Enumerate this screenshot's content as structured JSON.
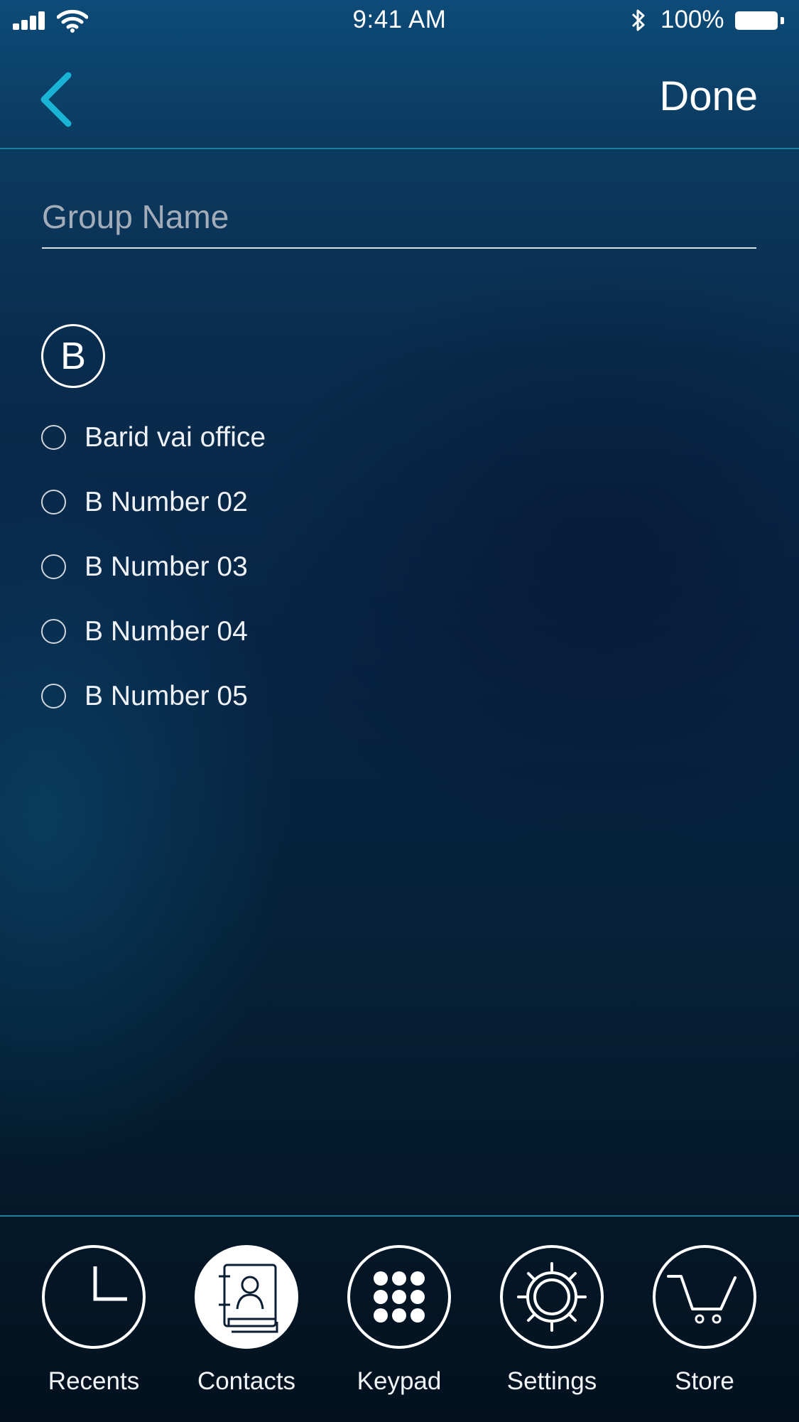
{
  "status_bar": {
    "time": "9:41 AM",
    "battery_percent": "100%",
    "icons": [
      "signal-icon",
      "wifi-icon",
      "bluetooth-icon",
      "battery-icon"
    ]
  },
  "nav": {
    "back_icon": "chevron-left-icon",
    "done_label": "Done"
  },
  "form": {
    "group_name_placeholder": "Group Name",
    "group_name_value": ""
  },
  "section": {
    "letter": "B"
  },
  "contacts": [
    {
      "name": "Barid vai office"
    },
    {
      "name": "B Number 02"
    },
    {
      "name": "B Number 03"
    },
    {
      "name": "B Number 04"
    },
    {
      "name": "B Number 05"
    }
  ],
  "tabs": [
    {
      "label": "Recents",
      "icon": "clock-icon",
      "active": false
    },
    {
      "label": "Contacts",
      "icon": "contacts-book-icon",
      "active": true
    },
    {
      "label": "Keypad",
      "icon": "keypad-icon",
      "active": false
    },
    {
      "label": "Settings",
      "icon": "gear-icon",
      "active": false
    },
    {
      "label": "Store",
      "icon": "cart-icon",
      "active": false
    }
  ],
  "colors": {
    "accent": "#19b3d6",
    "divider": "#1d7f9e",
    "background_top": "#0d4b78",
    "background_bottom": "#03111e"
  }
}
